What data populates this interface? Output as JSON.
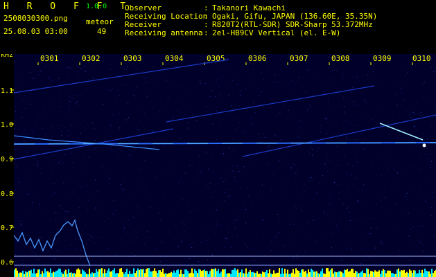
{
  "app": {
    "name": "H R O F F T",
    "version": "1.0.0"
  },
  "file": {
    "name": "2508030300.png",
    "timestamp": "25.08.03 03:00"
  },
  "meteor": {
    "label": "meteor",
    "count": "49"
  },
  "info": {
    "rows": [
      {
        "label": "Observer",
        "sep": ":",
        "value": "Takanori Kawachi"
      },
      {
        "label": "Receiving Location",
        "sep": ":",
        "value": "Ogaki, Gifu, JAPAN (136.60E, 35.35N)"
      },
      {
        "label": "Receiver",
        "sep": ":",
        "value": "R820T2(RTL-SDR) SDR-Sharp 53.372MHz"
      },
      {
        "label": "Receiving antenna",
        "sep": ":",
        "value": "2el-HB9CV Vertical (el. E-W)"
      }
    ]
  },
  "axis": {
    "unit": "kHz",
    "hours": [
      "0301",
      "0302",
      "0303",
      "0304",
      "0305",
      "0306",
      "0307",
      "0308",
      "0309",
      "0310"
    ],
    "freq_ticks": [
      "1.1",
      "1.0",
      "0.9",
      "0.8",
      "0.7",
      "0.6"
    ]
  },
  "colors": {
    "background": "#000000",
    "text_primary": "#ffff00",
    "text_secondary": "#00ff00",
    "spectrum_bg": "#00002a",
    "carrier": "#30b0ff",
    "bar": "#ffff00"
  }
}
